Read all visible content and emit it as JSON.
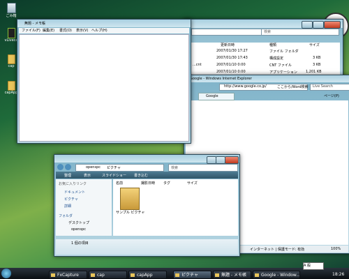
{
  "desktop": {
    "icons": [
      {
        "label": "ごみ箱"
      },
      {
        "label": "vLiveca"
      },
      {
        "label": "cap"
      },
      {
        "label": "capApp"
      }
    ]
  },
  "explorer_back": {
    "search_placeholder": "検索",
    "columns": [
      "更新日時",
      "種類",
      "サイズ"
    ],
    "rows": [
      {
        "name": "",
        "date": "2007/01/30 17:27",
        "type": "ファイル フォルダ",
        "size": ""
      },
      {
        "name": "",
        "date": "2007/01/30 17:43",
        "type": "構成設定",
        "size": "3 KB"
      },
      {
        "name": "...cnt",
        "date": "2007/01/10 0:00",
        "type": "CNT ファイル",
        "size": "3 KB"
      },
      {
        "name": "",
        "date": "2007/01/10 0:00",
        "type": "アプリケーション",
        "size": "1,201 KB"
      }
    ]
  },
  "ie": {
    "title": "Google - Windows Internet Explorer",
    "url": "http://www.google.co.jp/",
    "address_extra": "ここから/Word検索",
    "search_box": "Live Search",
    "tab": "Google",
    "page_menu": "ページ(P)"
  },
  "notepad": {
    "title": "無題 - メモ帳",
    "menu": [
      "ファイル(F)",
      "編集(E)",
      "書式(O)",
      "表示(V)",
      "ヘルプ(H)"
    ]
  },
  "pictures": {
    "path": [
      "openspc",
      "ピクチャ"
    ],
    "search_placeholder": "検索",
    "toolbar": [
      "整理",
      "表示",
      "スライドショー",
      "書き込む"
    ],
    "favorites_title": "お気に入りリンク",
    "favorites": [
      "ドキュメント",
      "ピクチャ",
      "詳細"
    ],
    "columns": [
      "名前",
      "撮影日時",
      "タグ",
      "サイズ"
    ],
    "folders_title": "フォルダ",
    "tree": [
      "デスクトップ",
      "openspc",
      "ナビゲーション"
    ],
    "item_label": "サンプル ピクチャ",
    "status": "1 個の項目"
  },
  "ie_status": {
    "zone": "インターネット | 保護モード: 有効",
    "zoom": "100%"
  },
  "taskbar": {
    "buttons": [
      "FxCapture",
      "cap",
      "capApp",
      "ピクチャ",
      "無題 - メモ帳",
      "Google - Window..."
    ],
    "lang": "A 般",
    "clock": "18:26"
  }
}
